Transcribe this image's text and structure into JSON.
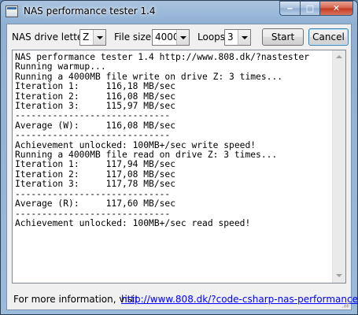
{
  "window": {
    "title": "NAS performance tester 1.4"
  },
  "caption_buttons": {
    "minimize": "‒",
    "maximize": "□",
    "close": "✕"
  },
  "controls": {
    "drive_label": "NAS drive letter",
    "drive_value": "Z",
    "filesize_label": "File size",
    "filesize_value": "4000",
    "loops_label": "Loops",
    "loops_value": "3",
    "start_label": "Start",
    "cancel_label": "Cancel"
  },
  "log": {
    "lines": [
      "NAS performance tester 1.4 http://www.808.dk/?nastester",
      "Running warmup...",
      "Running a 4000MB file write on drive Z: 3 times...",
      "Iteration 1:     116,18 MB/sec",
      "Iteration 2:     116,08 MB/sec",
      "Iteration 3:     115,97 MB/sec",
      "-----------------------------",
      "Average (W):     116,08 MB/sec",
      "-----------------------------",
      "Achievement unlocked: 100MB+/sec write speed!",
      "Running a 4000MB file read on drive Z: 3 times...",
      "Iteration 1:     117,94 MB/sec",
      "Iteration 2:     117,08 MB/sec",
      "Iteration 3:     117,78 MB/sec",
      "-----------------------------",
      "Average (R):     117,60 MB/sec",
      "-----------------------------",
      "Achievement unlocked: 100MB+/sec read speed!"
    ]
  },
  "footer": {
    "info_text": "For more information, visit",
    "link_text": "http://www.808.dk/?code-csharp-nas-performance"
  }
}
